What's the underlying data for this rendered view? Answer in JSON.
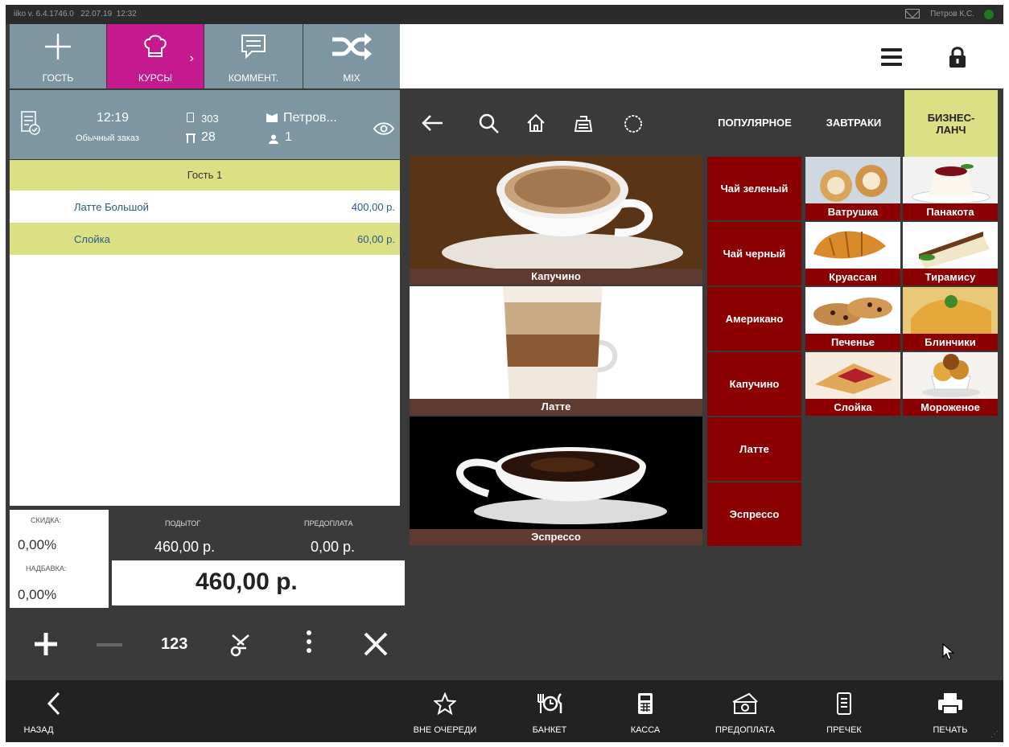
{
  "status_bar": {
    "version": "iiko v. 6.4.1746.0",
    "date": "22.07.19",
    "time": "12:32",
    "user": "Петров К.С."
  },
  "toolbar": {
    "gost_label": "ГОСТЬ",
    "kursy_label": "КУРСЫ",
    "comment_label": "КОММЕНТ.",
    "mix_label": "MIX"
  },
  "order": {
    "time": "12:19",
    "type": "Обычный заказ",
    "number": "303",
    "table": "28",
    "waiter": "Петров...",
    "guests": "1"
  },
  "guest_label": "Гость 1",
  "items": [
    {
      "name": "Латте Большой",
      "price": "400,00 р."
    },
    {
      "name": "Слойка",
      "price": "60,00 р."
    }
  ],
  "totals": {
    "discount_label": "СКИДКА:",
    "discount_value": "0,00%",
    "surcharge_label": "НАДБАВКА:",
    "surcharge_value": "0,00%",
    "subtotal_label": "ПОДЫТОГ",
    "subtotal_value": "460,00 р.",
    "prepay_label": "ПРЕДОПЛАТА",
    "prepay_value": "0,00 р.",
    "total": "460,00 р."
  },
  "tools": {
    "digits_label": "123"
  },
  "categories": {
    "popular": "ПОПУЛЯРНОЕ",
    "breakfast": "ЗАВТРАКИ",
    "business_lunch": "БИЗНЕС-ЛАНЧ"
  },
  "products_big": [
    "Капучино",
    "Латте",
    "Эспрессо"
  ],
  "products_red": [
    "Чай зеленый",
    "Чай черный",
    "Американо",
    "Капучино",
    "Латте",
    "Эспрессо"
  ],
  "products_small": [
    "Ватрушка",
    "Панакота",
    "Круассан",
    "Тирамису",
    "Печенье",
    "Блинчики",
    "Слойка",
    "Мороженое"
  ],
  "bottom_bar": {
    "back": "НАЗАД",
    "queue": "ВНЕ ОЧЕРЕДИ",
    "banquet": "БАНКЕТ",
    "cash": "КАССА",
    "prepay": "ПРЕДОПЛАТА",
    "precheck": "ПРЕЧЕК",
    "print": "ПЕЧАТЬ"
  },
  "colors": {
    "accent_magenta": "#c4198f",
    "toolbar_blue_grey": "#7e96a2",
    "guest_yellow": "#dbe085",
    "product_red": "#8b0000"
  }
}
